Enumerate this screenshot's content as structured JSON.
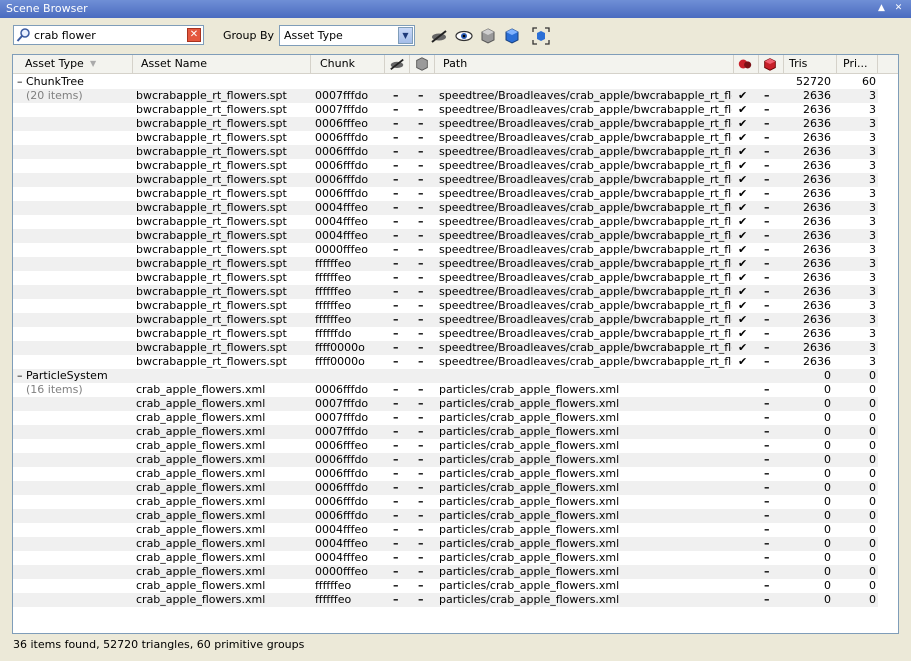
{
  "window": {
    "title": "Scene Browser",
    "pin_glyph": "▲",
    "close_glyph": "✕"
  },
  "toolbar": {
    "search_value": "crab flower",
    "clear_glyph": "✕",
    "group_by_label": "Group By",
    "group_by_value": "Asset Type",
    "dropdown_glyph": "▼"
  },
  "columns": {
    "asset_type": "Asset Type",
    "asset_name": "Asset Name",
    "chunk": "Chunk",
    "path": "Path",
    "tris": "Tris",
    "prims": "Pri..."
  },
  "groups": [
    {
      "name": "ChunkTree",
      "count_label": "(20 items)",
      "tris": "52720",
      "prims": "60",
      "rows": [
        {
          "name": "bwcrabapple_rt_flowers.spt",
          "chunk": "0007fffdo",
          "a": "–",
          "b": "–",
          "path": "speedtree/Broadleaves/crab_apple/bwcrabapple_rt_flow...",
          "check": "✔",
          "flag": "–",
          "tris": "2636",
          "prims": "3"
        },
        {
          "name": "bwcrabapple_rt_flowers.spt",
          "chunk": "0007fffdo",
          "a": "–",
          "b": "–",
          "path": "speedtree/Broadleaves/crab_apple/bwcrabapple_rt_flow...",
          "check": "✔",
          "flag": "–",
          "tris": "2636",
          "prims": "3"
        },
        {
          "name": "bwcrabapple_rt_flowers.spt",
          "chunk": "0006fffeo",
          "a": "–",
          "b": "–",
          "path": "speedtree/Broadleaves/crab_apple/bwcrabapple_rt_flow...",
          "check": "✔",
          "flag": "–",
          "tris": "2636",
          "prims": "3"
        },
        {
          "name": "bwcrabapple_rt_flowers.spt",
          "chunk": "0006fffdo",
          "a": "–",
          "b": "–",
          "path": "speedtree/Broadleaves/crab_apple/bwcrabapple_rt_flow...",
          "check": "✔",
          "flag": "–",
          "tris": "2636",
          "prims": "3"
        },
        {
          "name": "bwcrabapple_rt_flowers.spt",
          "chunk": "0006fffdo",
          "a": "–",
          "b": "–",
          "path": "speedtree/Broadleaves/crab_apple/bwcrabapple_rt_flow...",
          "check": "✔",
          "flag": "–",
          "tris": "2636",
          "prims": "3"
        },
        {
          "name": "bwcrabapple_rt_flowers.spt",
          "chunk": "0006fffdo",
          "a": "–",
          "b": "–",
          "path": "speedtree/Broadleaves/crab_apple/bwcrabapple_rt_flow...",
          "check": "✔",
          "flag": "–",
          "tris": "2636",
          "prims": "3"
        },
        {
          "name": "bwcrabapple_rt_flowers.spt",
          "chunk": "0006fffdo",
          "a": "–",
          "b": "–",
          "path": "speedtree/Broadleaves/crab_apple/bwcrabapple_rt_flow...",
          "check": "✔",
          "flag": "–",
          "tris": "2636",
          "prims": "3"
        },
        {
          "name": "bwcrabapple_rt_flowers.spt",
          "chunk": "0006fffdo",
          "a": "–",
          "b": "–",
          "path": "speedtree/Broadleaves/crab_apple/bwcrabapple_rt_flow...",
          "check": "✔",
          "flag": "–",
          "tris": "2636",
          "prims": "3"
        },
        {
          "name": "bwcrabapple_rt_flowers.spt",
          "chunk": "0004fffeo",
          "a": "–",
          "b": "–",
          "path": "speedtree/Broadleaves/crab_apple/bwcrabapple_rt_flow...",
          "check": "✔",
          "flag": "–",
          "tris": "2636",
          "prims": "3"
        },
        {
          "name": "bwcrabapple_rt_flowers.spt",
          "chunk": "0004fffeo",
          "a": "–",
          "b": "–",
          "path": "speedtree/Broadleaves/crab_apple/bwcrabapple_rt_flow...",
          "check": "✔",
          "flag": "–",
          "tris": "2636",
          "prims": "3"
        },
        {
          "name": "bwcrabapple_rt_flowers.spt",
          "chunk": "0004fffeo",
          "a": "–",
          "b": "–",
          "path": "speedtree/Broadleaves/crab_apple/bwcrabapple_rt_flow...",
          "check": "✔",
          "flag": "–",
          "tris": "2636",
          "prims": "3"
        },
        {
          "name": "bwcrabapple_rt_flowers.spt",
          "chunk": "0000fffeo",
          "a": "–",
          "b": "–",
          "path": "speedtree/Broadleaves/crab_apple/bwcrabapple_rt_flow...",
          "check": "✔",
          "flag": "–",
          "tris": "2636",
          "prims": "3"
        },
        {
          "name": "bwcrabapple_rt_flowers.spt",
          "chunk": "ffffffeo",
          "a": "–",
          "b": "–",
          "path": "speedtree/Broadleaves/crab_apple/bwcrabapple_rt_flow...",
          "check": "✔",
          "flag": "–",
          "tris": "2636",
          "prims": "3"
        },
        {
          "name": "bwcrabapple_rt_flowers.spt",
          "chunk": "ffffffeo",
          "a": "–",
          "b": "–",
          "path": "speedtree/Broadleaves/crab_apple/bwcrabapple_rt_flow...",
          "check": "✔",
          "flag": "–",
          "tris": "2636",
          "prims": "3"
        },
        {
          "name": "bwcrabapple_rt_flowers.spt",
          "chunk": "ffffffeo",
          "a": "–",
          "b": "–",
          "path": "speedtree/Broadleaves/crab_apple/bwcrabapple_rt_flow...",
          "check": "✔",
          "flag": "–",
          "tris": "2636",
          "prims": "3"
        },
        {
          "name": "bwcrabapple_rt_flowers.spt",
          "chunk": "ffffffeo",
          "a": "–",
          "b": "–",
          "path": "speedtree/Broadleaves/crab_apple/bwcrabapple_rt_flow...",
          "check": "✔",
          "flag": "–",
          "tris": "2636",
          "prims": "3"
        },
        {
          "name": "bwcrabapple_rt_flowers.spt",
          "chunk": "ffffffeo",
          "a": "–",
          "b": "–",
          "path": "speedtree/Broadleaves/crab_apple/bwcrabapple_rt_flow...",
          "check": "✔",
          "flag": "–",
          "tris": "2636",
          "prims": "3"
        },
        {
          "name": "bwcrabapple_rt_flowers.spt",
          "chunk": "ffffffdo",
          "a": "–",
          "b": "–",
          "path": "speedtree/Broadleaves/crab_apple/bwcrabapple_rt_flow...",
          "check": "✔",
          "flag": "–",
          "tris": "2636",
          "prims": "3"
        },
        {
          "name": "bwcrabapple_rt_flowers.spt",
          "chunk": "ffff0000o",
          "a": "–",
          "b": "–",
          "path": "speedtree/Broadleaves/crab_apple/bwcrabapple_rt_flow...",
          "check": "✔",
          "flag": "–",
          "tris": "2636",
          "prims": "3"
        },
        {
          "name": "bwcrabapple_rt_flowers.spt",
          "chunk": "ffff0000o",
          "a": "–",
          "b": "–",
          "path": "speedtree/Broadleaves/crab_apple/bwcrabapple_rt_flow...",
          "check": "✔",
          "flag": "–",
          "tris": "2636",
          "prims": "3"
        }
      ]
    },
    {
      "name": "ParticleSystem",
      "count_label": "(16 items)",
      "tris": "0",
      "prims": "0",
      "rows": [
        {
          "name": "crab_apple_flowers.xml",
          "chunk": "0006fffdo",
          "a": "–",
          "b": "–",
          "path": "particles/crab_apple_flowers.xml",
          "check": "",
          "flag": "–",
          "tris": "0",
          "prims": "0"
        },
        {
          "name": "crab_apple_flowers.xml",
          "chunk": "0007fffdo",
          "a": "–",
          "b": "–",
          "path": "particles/crab_apple_flowers.xml",
          "check": "",
          "flag": "–",
          "tris": "0",
          "prims": "0"
        },
        {
          "name": "crab_apple_flowers.xml",
          "chunk": "0007fffdo",
          "a": "–",
          "b": "–",
          "path": "particles/crab_apple_flowers.xml",
          "check": "",
          "flag": "–",
          "tris": "0",
          "prims": "0"
        },
        {
          "name": "crab_apple_flowers.xml",
          "chunk": "0007fffdo",
          "a": "–",
          "b": "–",
          "path": "particles/crab_apple_flowers.xml",
          "check": "",
          "flag": "–",
          "tris": "0",
          "prims": "0"
        },
        {
          "name": "crab_apple_flowers.xml",
          "chunk": "0006fffeo",
          "a": "–",
          "b": "–",
          "path": "particles/crab_apple_flowers.xml",
          "check": "",
          "flag": "–",
          "tris": "0",
          "prims": "0"
        },
        {
          "name": "crab_apple_flowers.xml",
          "chunk": "0006fffdo",
          "a": "–",
          "b": "–",
          "path": "particles/crab_apple_flowers.xml",
          "check": "",
          "flag": "–",
          "tris": "0",
          "prims": "0"
        },
        {
          "name": "crab_apple_flowers.xml",
          "chunk": "0006fffdo",
          "a": "–",
          "b": "–",
          "path": "particles/crab_apple_flowers.xml",
          "check": "",
          "flag": "–",
          "tris": "0",
          "prims": "0"
        },
        {
          "name": "crab_apple_flowers.xml",
          "chunk": "0006fffdo",
          "a": "–",
          "b": "–",
          "path": "particles/crab_apple_flowers.xml",
          "check": "",
          "flag": "–",
          "tris": "0",
          "prims": "0"
        },
        {
          "name": "crab_apple_flowers.xml",
          "chunk": "0006fffdo",
          "a": "–",
          "b": "–",
          "path": "particles/crab_apple_flowers.xml",
          "check": "",
          "flag": "–",
          "tris": "0",
          "prims": "0"
        },
        {
          "name": "crab_apple_flowers.xml",
          "chunk": "0006fffdo",
          "a": "–",
          "b": "–",
          "path": "particles/crab_apple_flowers.xml",
          "check": "",
          "flag": "–",
          "tris": "0",
          "prims": "0"
        },
        {
          "name": "crab_apple_flowers.xml",
          "chunk": "0004fffeo",
          "a": "–",
          "b": "–",
          "path": "particles/crab_apple_flowers.xml",
          "check": "",
          "flag": "–",
          "tris": "0",
          "prims": "0"
        },
        {
          "name": "crab_apple_flowers.xml",
          "chunk": "0004fffeo",
          "a": "–",
          "b": "–",
          "path": "particles/crab_apple_flowers.xml",
          "check": "",
          "flag": "–",
          "tris": "0",
          "prims": "0"
        },
        {
          "name": "crab_apple_flowers.xml",
          "chunk": "0004fffeo",
          "a": "–",
          "b": "–",
          "path": "particles/crab_apple_flowers.xml",
          "check": "",
          "flag": "–",
          "tris": "0",
          "prims": "0"
        },
        {
          "name": "crab_apple_flowers.xml",
          "chunk": "0000fffeo",
          "a": "–",
          "b": "–",
          "path": "particles/crab_apple_flowers.xml",
          "check": "",
          "flag": "–",
          "tris": "0",
          "prims": "0"
        },
        {
          "name": "crab_apple_flowers.xml",
          "chunk": "ffffffeo",
          "a": "–",
          "b": "–",
          "path": "particles/crab_apple_flowers.xml",
          "check": "",
          "flag": "–",
          "tris": "0",
          "prims": "0"
        },
        {
          "name": "crab_apple_flowers.xml",
          "chunk": "ffffffeo",
          "a": "–",
          "b": "–",
          "path": "particles/crab_apple_flowers.xml",
          "check": "",
          "flag": "–",
          "tris": "0",
          "prims": "0"
        }
      ]
    }
  ],
  "status": "36 items found, 52720 triangles, 60 primitive groups",
  "colors": {
    "title_bar": "#4a6bbf",
    "window_bg": "#ece9d8",
    "grid_bg": "#ffffff",
    "alt_row": "#f0f0f0"
  }
}
